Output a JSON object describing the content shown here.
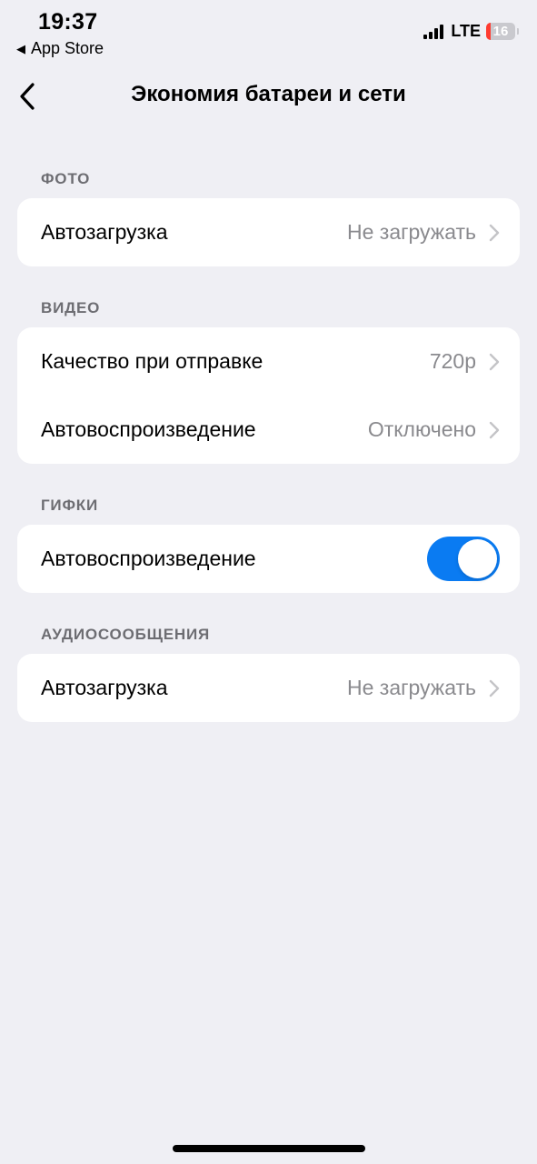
{
  "status_bar": {
    "time": "19:37",
    "back_app": "App Store",
    "network": "LTE",
    "battery_level": "16",
    "battery_fraction": 0.16,
    "battery_color": "#ff3b30"
  },
  "nav": {
    "title": "Экономия батареи и сети",
    "back_icon": "chevron-left-icon"
  },
  "sections": {
    "photo": {
      "header": "ФОТО",
      "rows": [
        {
          "label": "Автозагрузка",
          "value": "Не загружать"
        }
      ]
    },
    "video": {
      "header": "ВИДЕО",
      "rows": [
        {
          "label": "Качество при отправке",
          "value": "720p"
        },
        {
          "label": "Автовоспроизведение",
          "value": "Отключено"
        }
      ]
    },
    "gifs": {
      "header": "ГИФКИ",
      "rows": [
        {
          "label": "Автовоспроизведение",
          "toggle_on": true
        }
      ]
    },
    "audio": {
      "header": "АУДИОСООБЩЕНИЯ",
      "rows": [
        {
          "label": "Автозагрузка",
          "value": "Не загружать"
        }
      ]
    }
  },
  "colors": {
    "accent": "#0a7bf2",
    "background": "#efeff4",
    "secondary_text": "#8a8a8e",
    "section_header": "#6d6d72"
  }
}
